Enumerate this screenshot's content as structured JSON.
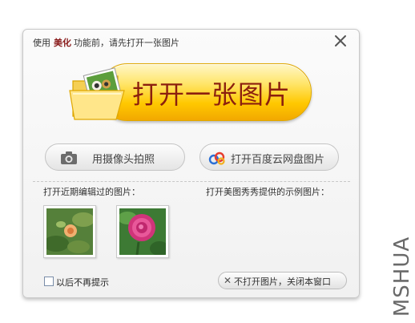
{
  "dialog": {
    "title_prefix": "使用",
    "title_emphasis": "美化",
    "title_suffix": "功能前，请先打开一张图片",
    "close_icon": "close-icon"
  },
  "open_image": {
    "label": "打开一张图片",
    "icon": "folder-photo-icon"
  },
  "camera_button": {
    "label": "用摄像头拍照",
    "icon": "camera-icon"
  },
  "cloud_button": {
    "label": "打开百度云网盘图片",
    "icon": "baidu-cloud-icon"
  },
  "recent": {
    "label": "打开近期编辑过的图片：",
    "thumbnails": [
      "flower-photo-1",
      "flower-photo-2"
    ]
  },
  "examples": {
    "label": "打开美图秀秀提供的示例图片："
  },
  "footer": {
    "checkbox_label": "以后不再提示",
    "checkbox_checked": false,
    "close_label": "不打开图片，关闭本窗口",
    "close_icon": "x-icon"
  },
  "watermark": {
    "text": "MSHUA"
  },
  "colors": {
    "accent_text": "#8b1f0e",
    "button_yellow": "#ffc800",
    "emphasis": "#8a1c1c"
  }
}
